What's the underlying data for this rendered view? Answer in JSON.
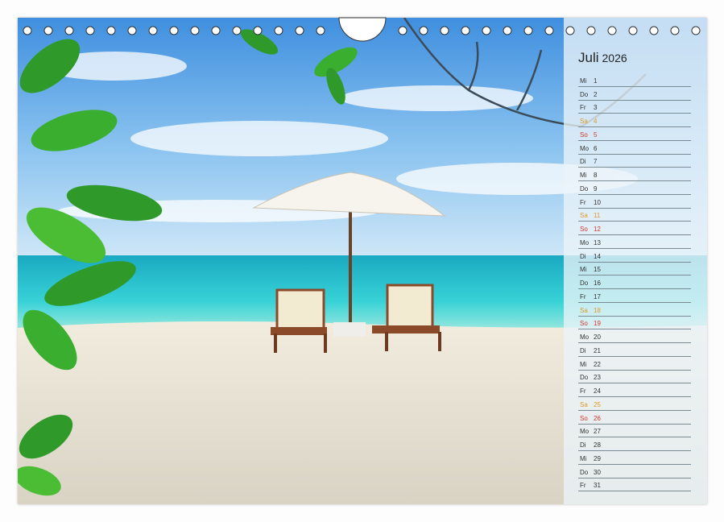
{
  "calendar": {
    "month": "Juli",
    "year": "2026",
    "days": [
      {
        "wd": "Mi",
        "d": "1",
        "type": ""
      },
      {
        "wd": "Do",
        "d": "2",
        "type": ""
      },
      {
        "wd": "Fr",
        "d": "3",
        "type": ""
      },
      {
        "wd": "Sa",
        "d": "4",
        "type": "sa"
      },
      {
        "wd": "So",
        "d": "5",
        "type": "so"
      },
      {
        "wd": "Mo",
        "d": "6",
        "type": ""
      },
      {
        "wd": "Di",
        "d": "7",
        "type": ""
      },
      {
        "wd": "Mi",
        "d": "8",
        "type": ""
      },
      {
        "wd": "Do",
        "d": "9",
        "type": ""
      },
      {
        "wd": "Fr",
        "d": "10",
        "type": ""
      },
      {
        "wd": "Sa",
        "d": "11",
        "type": "sa"
      },
      {
        "wd": "So",
        "d": "12",
        "type": "so"
      },
      {
        "wd": "Mo",
        "d": "13",
        "type": ""
      },
      {
        "wd": "Di",
        "d": "14",
        "type": ""
      },
      {
        "wd": "Mi",
        "d": "15",
        "type": ""
      },
      {
        "wd": "Do",
        "d": "16",
        "type": ""
      },
      {
        "wd": "Fr",
        "d": "17",
        "type": ""
      },
      {
        "wd": "Sa",
        "d": "18",
        "type": "sa"
      },
      {
        "wd": "So",
        "d": "19",
        "type": "so"
      },
      {
        "wd": "Mo",
        "d": "20",
        "type": ""
      },
      {
        "wd": "Di",
        "d": "21",
        "type": ""
      },
      {
        "wd": "Mi",
        "d": "22",
        "type": ""
      },
      {
        "wd": "Do",
        "d": "23",
        "type": ""
      },
      {
        "wd": "Fr",
        "d": "24",
        "type": ""
      },
      {
        "wd": "Sa",
        "d": "25",
        "type": "sa"
      },
      {
        "wd": "So",
        "d": "26",
        "type": "so"
      },
      {
        "wd": "Mo",
        "d": "27",
        "type": ""
      },
      {
        "wd": "Di",
        "d": "28",
        "type": ""
      },
      {
        "wd": "Mi",
        "d": "29",
        "type": ""
      },
      {
        "wd": "Do",
        "d": "30",
        "type": ""
      },
      {
        "wd": "Fr",
        "d": "31",
        "type": ""
      }
    ]
  },
  "colors": {
    "saturday": "#e09a2a",
    "sunday": "#d8332a",
    "sky": "#5fa8e6",
    "sea": "#2cc4cf",
    "sand": "#e6e0cf",
    "leaf": "#2f9a2a"
  }
}
